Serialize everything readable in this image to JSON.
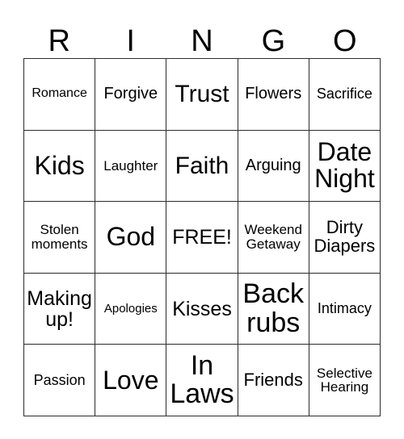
{
  "card": {
    "title_letters": [
      "R",
      "I",
      "N",
      "G",
      "O"
    ],
    "free_space_label": "FREE!",
    "colors": {
      "border": "#2b2b2b",
      "text": "#000000",
      "background": "#ffffff"
    },
    "rows": [
      [
        {
          "text": "Romance",
          "size": "fs-16"
        },
        {
          "text": "Forgive",
          "size": "fs-20"
        },
        {
          "text": "Trust",
          "size": "fs-30"
        },
        {
          "text": "Flowers",
          "size": "fs-20"
        },
        {
          "text": "Sacrifice",
          "size": "fs-18"
        }
      ],
      [
        {
          "text": "Kids",
          "size": "fs-32"
        },
        {
          "text": "Laughter",
          "size": "fs-17"
        },
        {
          "text": "Faith",
          "size": "fs-30"
        },
        {
          "text": "Arguing",
          "size": "fs-20"
        },
        {
          "text": "Date\nNight",
          "size": "fs-32"
        }
      ],
      [
        {
          "text": "Stolen\nmoments",
          "size": "fs-17"
        },
        {
          "text": "God",
          "size": "fs-32"
        },
        {
          "text": "FREE!",
          "size": "fs-25"
        },
        {
          "text": "Weekend\nGetaway",
          "size": "fs-17"
        },
        {
          "text": "Dirty\nDiapers",
          "size": "fs-22"
        }
      ],
      [
        {
          "text": "Making\nup!",
          "size": "fs-25"
        },
        {
          "text": "Apologies",
          "size": "fs-15"
        },
        {
          "text": "Kisses",
          "size": "fs-25"
        },
        {
          "text": "Back\nrubs",
          "size": "fs-34"
        },
        {
          "text": "Intimacy",
          "size": "fs-18"
        }
      ],
      [
        {
          "text": "Passion",
          "size": "fs-18"
        },
        {
          "text": "Love",
          "size": "fs-32"
        },
        {
          "text": "In\nLaws",
          "size": "fs-34"
        },
        {
          "text": "Friends",
          "size": "fs-22"
        },
        {
          "text": "Selective\nHearing",
          "size": "fs-17"
        }
      ]
    ]
  }
}
